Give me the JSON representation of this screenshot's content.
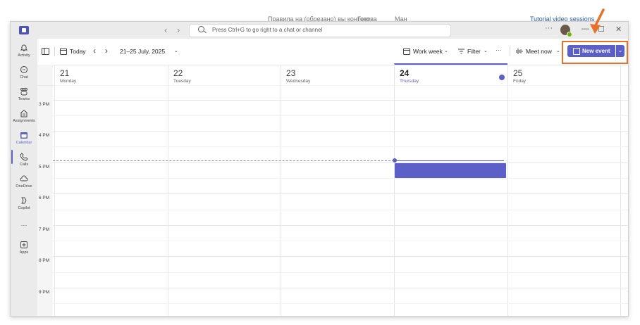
{
  "background_fragments": {
    "frag1": "Правила на (обрезано) вы контент",
    "frag2": "Готова",
    "frag3": "Ман",
    "frag4": "Tutorial video sessions"
  },
  "titlebar": {
    "search_placeholder": "Press Ctrl+G to go right to a chat or channel",
    "more": "···",
    "minimize": "—",
    "maximize": "☐",
    "close": "✕"
  },
  "rail": {
    "items": [
      {
        "label": "Activity",
        "icon": "bell-icon"
      },
      {
        "label": "Chat",
        "icon": "chat-icon"
      },
      {
        "label": "Teams",
        "icon": "teams-icon"
      },
      {
        "label": "Assignments",
        "icon": "assignments-icon"
      },
      {
        "label": "Calendar",
        "icon": "calendar-icon"
      },
      {
        "label": "Calls",
        "icon": "phone-icon"
      },
      {
        "label": "OneDrive",
        "icon": "cloud-icon"
      },
      {
        "label": "Copilot",
        "icon": "copilot-icon"
      },
      {
        "label": "···",
        "icon": "more-icon"
      },
      {
        "label": "Apps",
        "icon": "apps-icon"
      }
    ]
  },
  "toolbar": {
    "today": "Today",
    "date_range": "21–25 July, 2025",
    "view": "Work week",
    "filter": "Filter",
    "more": "···",
    "meet_now": "Meet now",
    "new_event": "New event"
  },
  "days": [
    {
      "num": "21",
      "weekday": "Monday"
    },
    {
      "num": "22",
      "weekday": "Tuesday"
    },
    {
      "num": "23",
      "weekday": "Wednesday"
    },
    {
      "num": "24",
      "weekday": "Thursday"
    },
    {
      "num": "25",
      "weekday": "Friday"
    }
  ],
  "times": [
    "3 PM",
    "4 PM",
    "5 PM",
    "6 PM",
    "7 PM",
    "8 PM",
    "9 PM"
  ],
  "colors": {
    "accent": "#5b5fc7",
    "annotation": "#e8702a"
  }
}
